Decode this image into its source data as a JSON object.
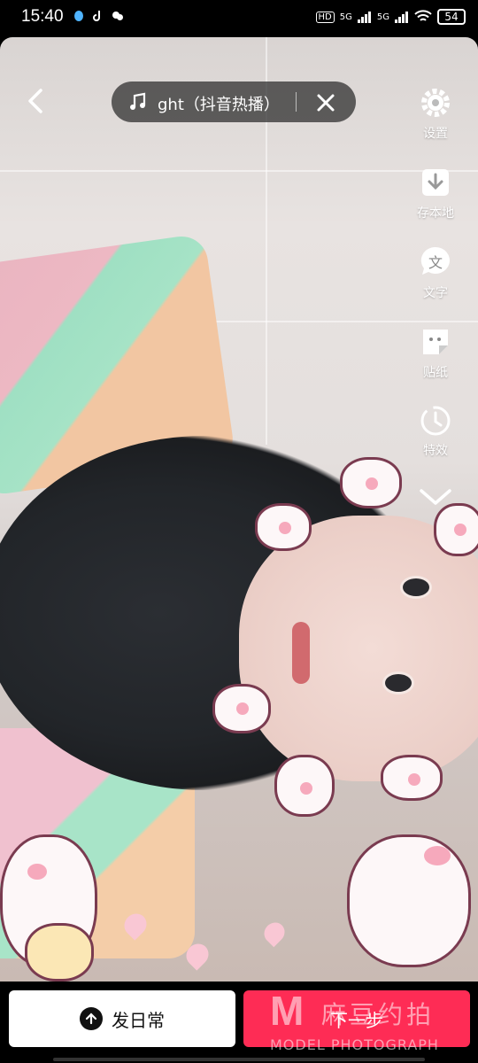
{
  "status_bar": {
    "time": "15:40",
    "network_1": "5G",
    "network_2": "5G",
    "hd_label": "HD",
    "battery": "54"
  },
  "top_bar": {
    "music_title": "ght（抖音热播）",
    "icons": {
      "back": "chevron-left-icon",
      "music": "music-note-icon",
      "close": "close-icon"
    }
  },
  "side_tools": {
    "items": [
      {
        "label": "设置",
        "icon": "gear-icon"
      },
      {
        "label": "存本地",
        "icon": "download-icon"
      },
      {
        "label": "文字",
        "icon": "text-bubble-icon"
      },
      {
        "label": "贴纸",
        "icon": "sticker-icon"
      },
      {
        "label": "特效",
        "icon": "effects-timer-icon"
      }
    ],
    "more_icon": "chevron-down-icon"
  },
  "bottom_bar": {
    "daily_label": "发日常",
    "next_label": "下一步",
    "accent": "#fe2c55"
  },
  "watermark": {
    "mark": "M",
    "cn": "麻豆约拍",
    "en": "MODEL PHOTOGRAPH"
  }
}
